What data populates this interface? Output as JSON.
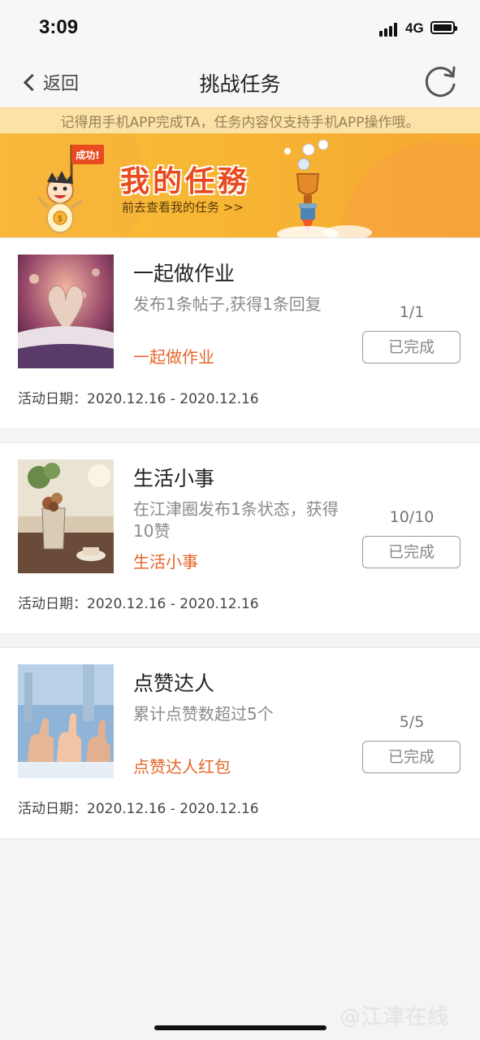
{
  "status_bar": {
    "time": "3:09",
    "network": "4G"
  },
  "nav": {
    "back_label": "返回",
    "title": "挑战任务"
  },
  "notice": "记得用手机APP完成TA，任务内容仅支持手机APP操作哦。",
  "banner": {
    "flag_text": "成功!",
    "title": "我的任務",
    "link": "前去查看我的任务 >>"
  },
  "tasks": [
    {
      "title": "一起做作业",
      "desc": "发布1条帖子,获得1条回复",
      "link": "一起做作业",
      "progress": "1/1",
      "button": "已完成",
      "date": "活动日期：2020.12.16 - 2020.12.16"
    },
    {
      "title": "生活小事",
      "desc": "在江津圈发布1条状态，获得10赞",
      "link": "生活小事",
      "progress": "10/10",
      "button": "已完成",
      "date": "活动日期：2020.12.16 - 2020.12.16"
    },
    {
      "title": "点赞达人",
      "desc": "累计点赞数超过5个",
      "link": "点赞达人红包",
      "progress": "5/5",
      "button": "已完成",
      "date": "活动日期：2020.12.16 - 2020.12.16"
    }
  ],
  "watermark": "@江津在线",
  "colors": {
    "accent": "#e5672b",
    "banner": "#f7b733",
    "notice_bg": "#fbe3a8"
  }
}
